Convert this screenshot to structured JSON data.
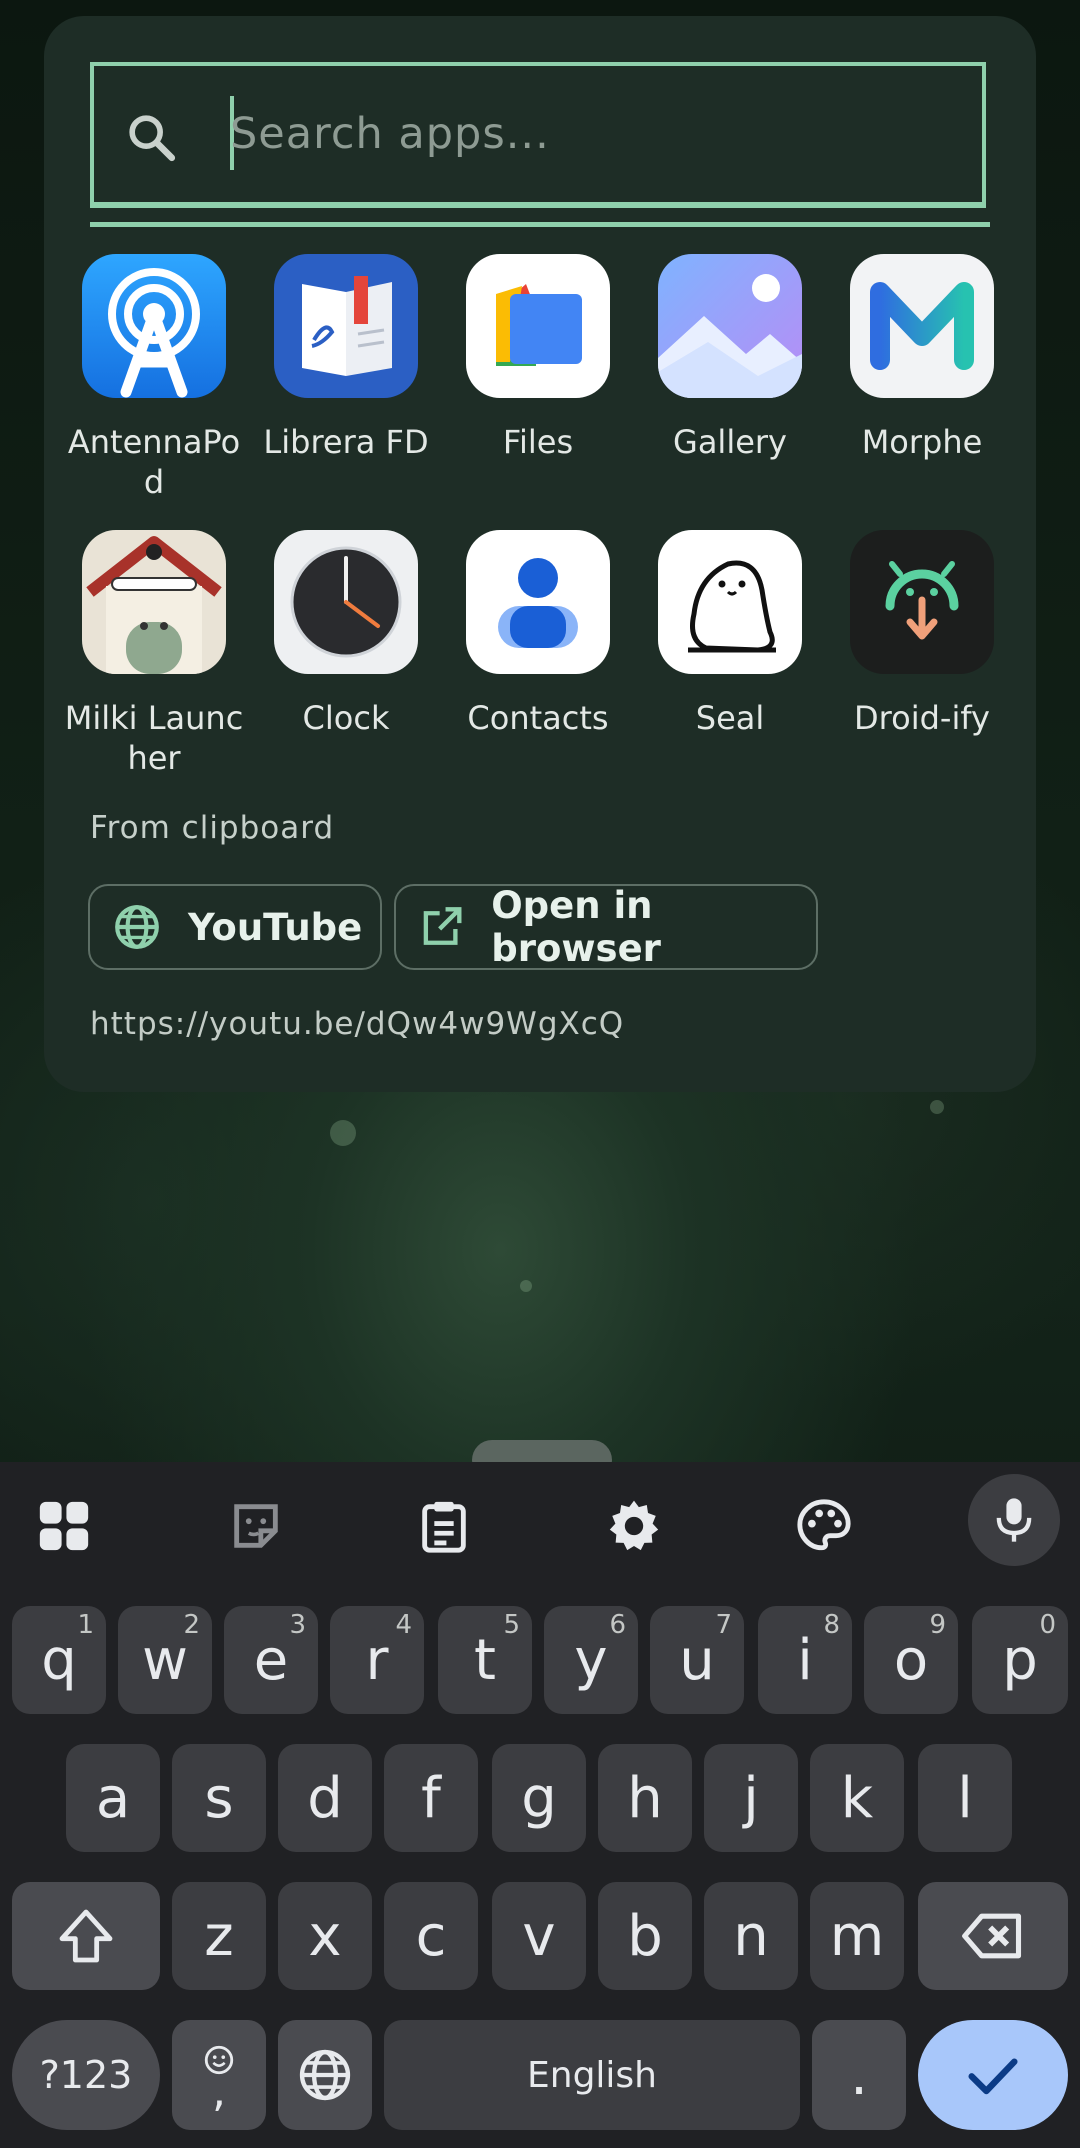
{
  "search": {
    "placeholder": "Search apps..."
  },
  "apps": [
    {
      "label": "AntennaPod",
      "icon": "antennapod-icon"
    },
    {
      "label": "Librera FD",
      "icon": "librera-icon"
    },
    {
      "label": "Files",
      "icon": "files-icon"
    },
    {
      "label": "Gallery",
      "icon": "gallery-icon"
    },
    {
      "label": "Morphe",
      "icon": "morphe-icon"
    },
    {
      "label": "Milki Launcher",
      "icon": "milki-launcher-icon"
    },
    {
      "label": "Clock",
      "icon": "clock-icon"
    },
    {
      "label": "Contacts",
      "icon": "contacts-icon"
    },
    {
      "label": "Seal",
      "icon": "seal-icon"
    },
    {
      "label": "Droid-ify",
      "icon": "droidify-icon"
    }
  ],
  "clipboard": {
    "section_label": "From clipboard",
    "youtube_label": "YouTube",
    "browser_label": "Open in browser",
    "url": "https://youtu.be/dQw4w9WgXcQ"
  },
  "keyboard": {
    "row1": [
      {
        "key": "q",
        "hint": "1"
      },
      {
        "key": "w",
        "hint": "2"
      },
      {
        "key": "e",
        "hint": "3"
      },
      {
        "key": "r",
        "hint": "4"
      },
      {
        "key": "t",
        "hint": "5"
      },
      {
        "key": "y",
        "hint": "6"
      },
      {
        "key": "u",
        "hint": "7"
      },
      {
        "key": "i",
        "hint": "8"
      },
      {
        "key": "o",
        "hint": "9"
      },
      {
        "key": "p",
        "hint": "0"
      }
    ],
    "row2": [
      "a",
      "s",
      "d",
      "f",
      "g",
      "h",
      "j",
      "k",
      "l"
    ],
    "row3": [
      "z",
      "x",
      "c",
      "v",
      "b",
      "n",
      "m"
    ],
    "symbols_label": "?123",
    "comma_label": ",",
    "space_label": "English",
    "period_label": "."
  },
  "colors": {
    "accent": "#8fd0ac",
    "panel": "#1e2d26",
    "enter": "#a8c7fa"
  }
}
